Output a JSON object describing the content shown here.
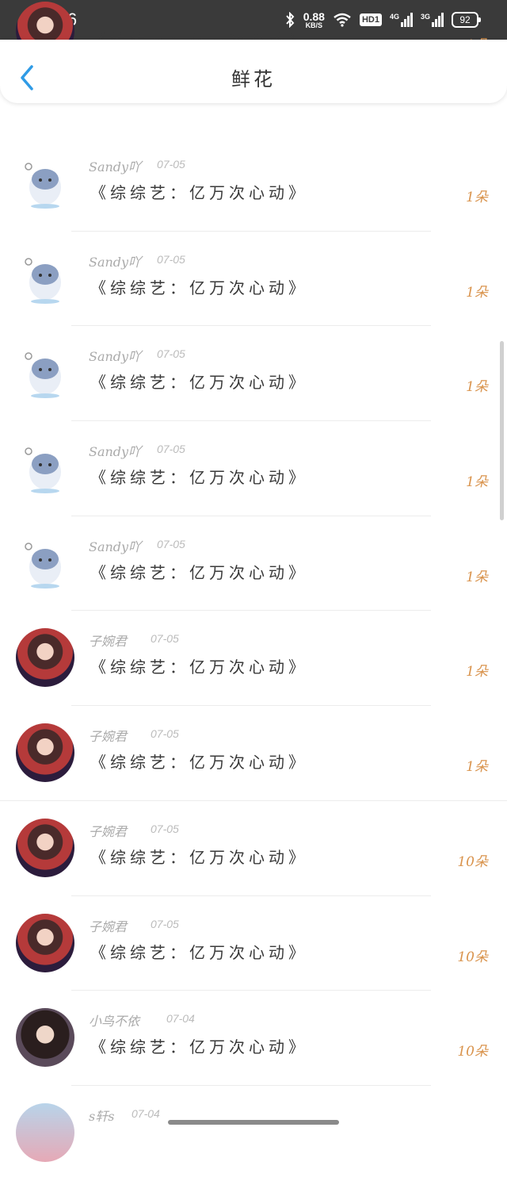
{
  "status_bar": {
    "time": "14:26",
    "net_speed_value": "0.88",
    "net_speed_unit": "KB/S",
    "hd_badge": "HD1",
    "signal1_label": "4G",
    "signal2_label": "3G",
    "battery": "92"
  },
  "header": {
    "title": "鲜花"
  },
  "list": [
    {
      "name": "",
      "date": "",
      "title": "《综综艺：亿万次心动》",
      "amount": "1朵",
      "avatar": "girl"
    },
    {
      "name": "Sandy吖",
      "date": "07-05",
      "title": "《综综艺：亿万次心动》",
      "amount": "1朵",
      "avatar": "hamster"
    },
    {
      "name": "Sandy吖",
      "date": "07-05",
      "title": "《综综艺：亿万次心动》",
      "amount": "1朵",
      "avatar": "hamster"
    },
    {
      "name": "Sandy吖",
      "date": "07-05",
      "title": "《综综艺：亿万次心动》",
      "amount": "1朵",
      "avatar": "hamster"
    },
    {
      "name": "Sandy吖",
      "date": "07-05",
      "title": "《综综艺：亿万次心动》",
      "amount": "1朵",
      "avatar": "hamster"
    },
    {
      "name": "Sandy吖",
      "date": "07-05",
      "title": "《综综艺：亿万次心动》",
      "amount": "1朵",
      "avatar": "hamster"
    },
    {
      "name": "子婉君",
      "date": "07-05",
      "title": "《综综艺：亿万次心动》",
      "amount": "1朵",
      "avatar": "girl"
    },
    {
      "name": "子婉君",
      "date": "07-05",
      "title": "《综综艺：亿万次心动》",
      "amount": "1朵",
      "avatar": "girl"
    },
    {
      "name": "子婉君",
      "date": "07-05",
      "title": "《综综艺：亿万次心动》",
      "amount": "10朵",
      "avatar": "girl"
    },
    {
      "name": "子婉君",
      "date": "07-05",
      "title": "《综综艺：亿万次心动》",
      "amount": "10朵",
      "avatar": "girl"
    },
    {
      "name": "小鸟不依",
      "date": "07-04",
      "title": "《综综艺：亿万次心动》",
      "amount": "10朵",
      "avatar": "girl2"
    },
    {
      "name": "s轩s",
      "date": "07-04",
      "title": "",
      "amount": "",
      "avatar": "sky"
    }
  ],
  "colors": {
    "accent_blue": "#2f9be6",
    "amount_orange": "#d9934c",
    "status_bar_bg": "#3a3a3a"
  },
  "icons": {
    "back": "chevron-left-icon",
    "bluetooth": "bluetooth-icon",
    "wifi": "wifi-icon"
  }
}
